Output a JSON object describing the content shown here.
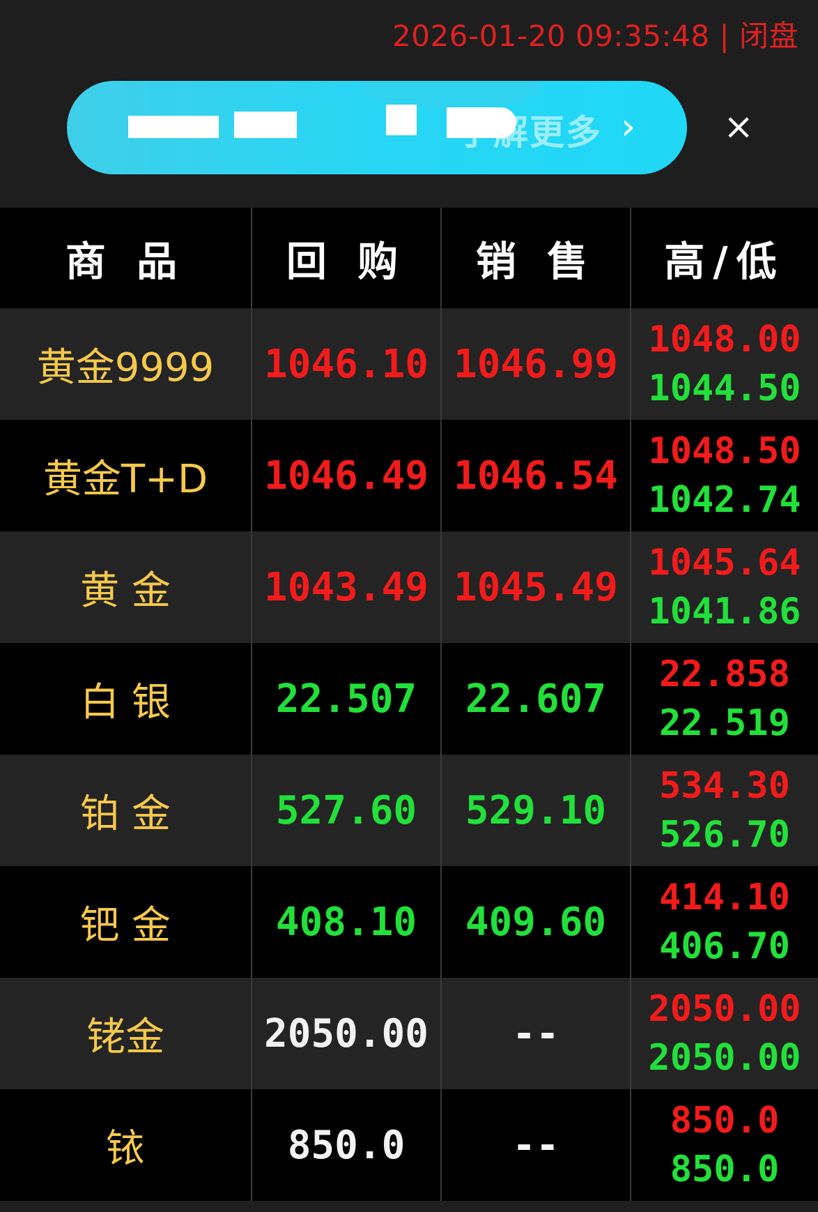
{
  "status": {
    "datetime": "2026-01-20 09:35:48",
    "separator": " | ",
    "market_state": "闭盘"
  },
  "banner": {
    "close_label": "×",
    "arrow": "›",
    "visible_text": "了解更多"
  },
  "table": {
    "headers": [
      "商 品",
      "回 购",
      "销 售",
      "高/低"
    ],
    "rows": [
      {
        "name": "黄金9999",
        "buy": "1046.10",
        "sell": "1046.99",
        "high": "1048.00",
        "low": "1044.50",
        "buy_color": "red",
        "sell_color": "red"
      },
      {
        "name": "黄金T+D",
        "buy": "1046.49",
        "sell": "1046.54",
        "high": "1048.50",
        "low": "1042.74",
        "buy_color": "red",
        "sell_color": "red"
      },
      {
        "name": "黄 金",
        "buy": "1043.49",
        "sell": "1045.49",
        "high": "1045.64",
        "low": "1041.86",
        "buy_color": "red",
        "sell_color": "red"
      },
      {
        "name": "白 银",
        "buy": "22.507",
        "sell": "22.607",
        "high": "22.858",
        "low": "22.519",
        "buy_color": "green",
        "sell_color": "green"
      },
      {
        "name": "铂 金",
        "buy": "527.60",
        "sell": "529.10",
        "high": "534.30",
        "low": "526.70",
        "buy_color": "green",
        "sell_color": "green"
      },
      {
        "name": "钯 金",
        "buy": "408.10",
        "sell": "409.60",
        "high": "414.10",
        "low": "406.70",
        "buy_color": "green",
        "sell_color": "green"
      },
      {
        "name": "铑金",
        "buy": "2050.00",
        "sell": "--",
        "high": "2050.00",
        "low": "2050.00",
        "buy_color": "white",
        "sell_color": "white"
      },
      {
        "name": "铱",
        "buy": "850.0",
        "sell": "--",
        "high": "850.0",
        "low": "850.0",
        "buy_color": "white",
        "sell_color": "white"
      }
    ]
  },
  "colors": {
    "up": "#f21b1b",
    "down": "#22e03a",
    "neutral": "#f2f2f2",
    "name": "#f6c94a",
    "banner": "#27d6f4"
  }
}
